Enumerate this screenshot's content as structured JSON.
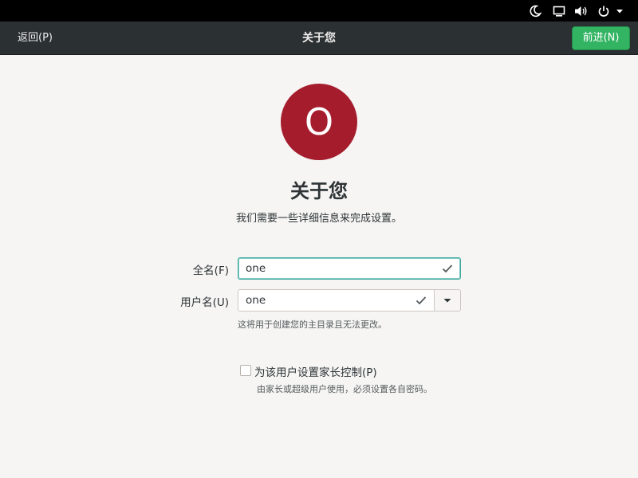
{
  "top_panel": {
    "icons": [
      "night-light-icon",
      "display-icon",
      "volume-icon",
      "power-icon",
      "chevron-down-icon"
    ]
  },
  "header": {
    "back_label": "返回(P)",
    "title": "关于您",
    "next_label": "前进(N)",
    "next_color": "#33b463"
  },
  "avatar": {
    "letter": "O",
    "color": "#a51d2d"
  },
  "main": {
    "title": "关于您",
    "subtitle": "我们需要一些详细信息来完成设置。"
  },
  "form": {
    "fullname_label": "全名(F)",
    "fullname_value": "one",
    "username_label": "用户名(U)",
    "username_value": "one",
    "username_hint": "这将用于创建您的主目录且无法更改。",
    "parental_label": "为该用户设置家长控制(P)",
    "parental_checked": false,
    "parental_hint": "由家长或超级用户使用，必须设置各自密码。"
  }
}
